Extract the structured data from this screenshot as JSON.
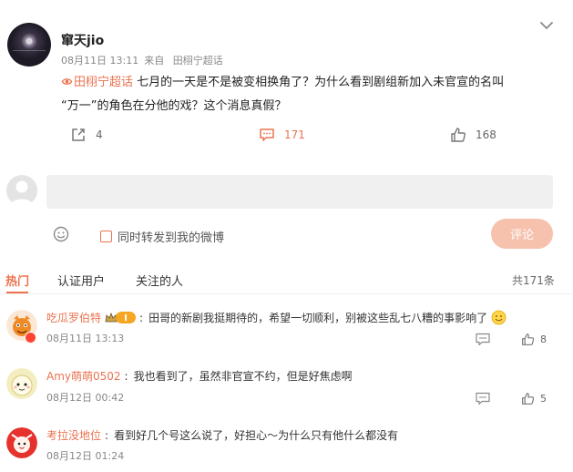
{
  "post": {
    "author": "窜天jio",
    "date": "08月11日 13:11",
    "source_prefix": "来自",
    "source": "田栩宁超话",
    "topic": "田栩宁超话",
    "text_line1": " 七月的一天是不是被变相换角了？为什么看到剧组新加入未官宣的名叫",
    "text_line2": "“万一”的角色在分他的戏？这个消息真假？",
    "forward_count": "4",
    "comment_count": "171",
    "like_count": "168"
  },
  "composer": {
    "repost_label": "同时转发到我的微博",
    "submit_label": "评论"
  },
  "tabs": {
    "hot": "热门",
    "verified": "认证用户",
    "following": "关注的人",
    "total": "共171条"
  },
  "comments": [
    {
      "user": "吃瓜罗伯特",
      "text": "田哥的新剧我挺期待的，希望一切顺利，别被这些乱七八糟的事影响了",
      "time": "08月11日 13:13",
      "likes": "8"
    },
    {
      "user": "Amy萌萌0502",
      "text": "我也看到了，虽然非官宣不约，但是好焦虑啊",
      "time": "08月12日 00:42",
      "likes": "5"
    },
    {
      "user": "考拉没地位",
      "text": "看到好几个号这么说了，好担心～为什么只有他什么都没有",
      "time": "08月12日 01:24",
      "likes": ""
    }
  ],
  "colors": {
    "accent": "#eb7350",
    "submit_disabled": "#f6c2ae"
  },
  "icons": {
    "collapse": "chevron-down-icon",
    "forward": "share-icon",
    "comment": "comment-icon",
    "like": "thumbs-up-icon",
    "emoji": "smiley-icon",
    "topic": "super-topic-icon"
  }
}
